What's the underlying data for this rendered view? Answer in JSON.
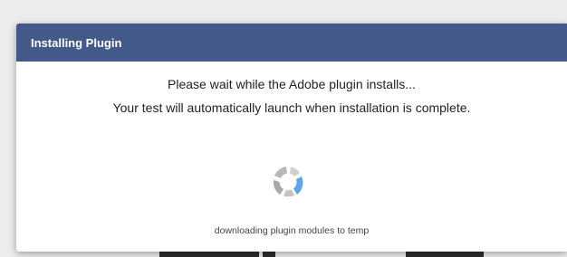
{
  "dialog": {
    "title": "Installing Plugin",
    "message_line1": "Please wait while the Adobe plugin installs...",
    "message_line2": "Your test will automatically launch when installation is complete.",
    "status_text": "downloading plugin modules to temp"
  },
  "colors": {
    "header_bg": "#42598a",
    "spinner_gray": "#b4b4b4",
    "spinner_blue": "#5aa6ea"
  },
  "icons": {
    "spinner": "loading-spinner-icon"
  }
}
